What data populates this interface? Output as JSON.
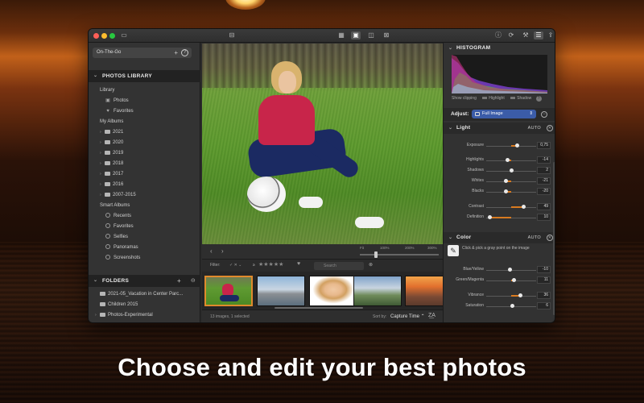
{
  "tagline": "Choose and edit your best photos",
  "colors": {
    "accent": "#d87a20",
    "selection": "#3b5ca8",
    "thumb_border": "#e08a2c"
  },
  "toolbar": {
    "left_icons": [
      "sidebar-toggle-icon"
    ],
    "center_icons": [
      "import-icon",
      "grid-view-icon",
      "single-view-icon",
      "compare-view-icon",
      "fullscreen-view-icon"
    ],
    "right_icons": [
      "info-icon",
      "sync-icon",
      "tools-icon",
      "adjust-icon",
      "share-icon"
    ]
  },
  "sidebar": {
    "on_the_go": "On-The-Go",
    "library_header": "PHOTOS LIBRARY",
    "library_label": "Library",
    "library_items": [
      "Photos",
      "Favorites"
    ],
    "my_albums_label": "My Albums",
    "albums": [
      "2021",
      "2020",
      "2019",
      "2018",
      "2017",
      "2016",
      "2007-2015"
    ],
    "smart_albums_label": "Smart Albums",
    "smart_albums": [
      "Recents",
      "Favorites",
      "Selfies",
      "Panoramas",
      "Screenshots"
    ],
    "folders_header": "FOLDERS",
    "folders": [
      "2021-05_Vacation in Center Parc...",
      "Children 2015",
      "Photos-Experimental"
    ]
  },
  "viewer": {
    "zoom_labels": [
      "Fit",
      "100%",
      "200%",
      "300%"
    ]
  },
  "filter": {
    "label": "Filter:",
    "rating_prefix": "≥",
    "stars": "★★★★★",
    "search_placeholder": "Search"
  },
  "status": {
    "count": "13 images, 1 selected",
    "sort_label": "Sort by:",
    "sort_value": "Capture Time"
  },
  "panel": {
    "histogram_header": "HISTOGRAM",
    "show_clipping": "Show clipping",
    "highlight": "Highlight",
    "shadow": "Shadow",
    "adjust_label": "Adjust:",
    "adjust_value": "Full Image",
    "light_header": "Light",
    "auto": "AUTO",
    "color_header": "Color",
    "picker_text": "Click & pick a gray point on the image",
    "light_sliders": [
      {
        "label": "Exposure",
        "value": "0,75",
        "pos": 0.62
      },
      {
        "label": "Highlights",
        "value": "-14",
        "pos": 0.43
      },
      {
        "label": "Shadows",
        "value": "2",
        "pos": 0.51
      },
      {
        "label": "Whites",
        "value": "-21",
        "pos": 0.4
      },
      {
        "label": "Blacks",
        "value": "-20",
        "pos": 0.4
      },
      {
        "label": "Contrast",
        "value": "49",
        "pos": 0.75
      },
      {
        "label": "Definition",
        "value": "10",
        "pos": 0.08
      }
    ],
    "color_sliders": [
      {
        "label": "Blue/Yellow",
        "value": "-10",
        "pos": 0.47
      },
      {
        "label": "Green/Magenta",
        "value": "11",
        "pos": 0.55
      },
      {
        "label": "Vibrance",
        "value": "36",
        "pos": 0.68
      },
      {
        "label": "Saturation",
        "value": "6",
        "pos": 0.53
      }
    ]
  }
}
